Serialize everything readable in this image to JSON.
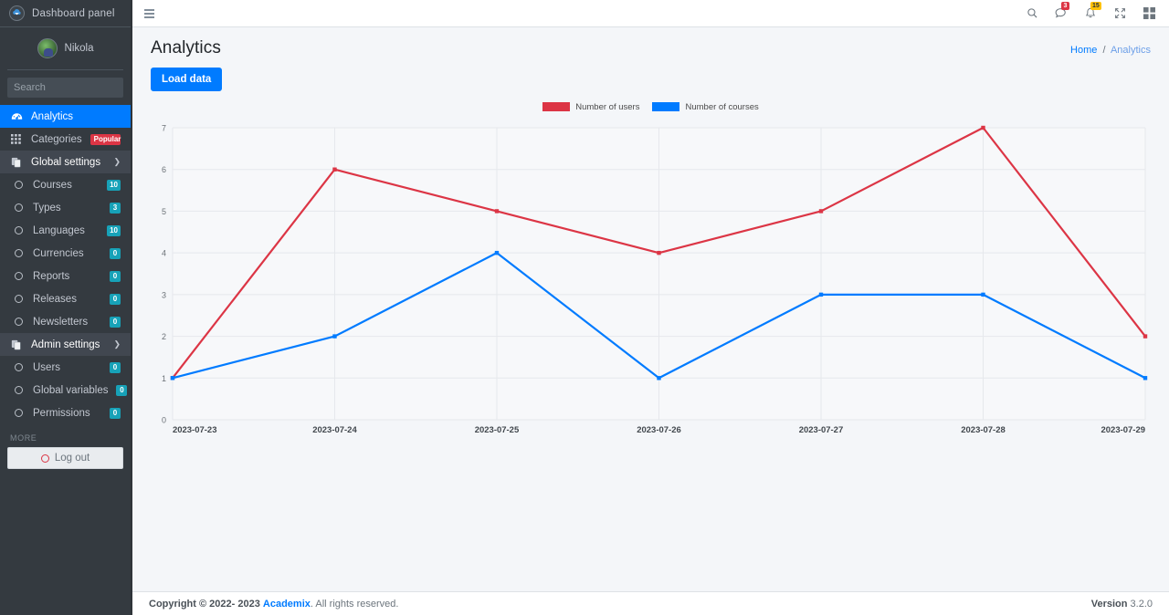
{
  "brand": {
    "title": "Dashboard panel",
    "logo_icon": "cloud-logo-icon"
  },
  "user": {
    "name": "Nikola"
  },
  "search": {
    "placeholder": "Search",
    "value": "",
    "icon": "search-icon"
  },
  "sidebar": {
    "items": [
      {
        "label": "Analytics",
        "icon": "tachometer-icon",
        "state": "active",
        "level": "top"
      },
      {
        "label": "Categories",
        "icon": "grid-icon",
        "badge": "Popular",
        "badge_type": "danger",
        "level": "top"
      },
      {
        "label": "Global settings",
        "icon": "copy-icon",
        "state": "open",
        "chevron": "chevron-down-icon",
        "level": "top"
      },
      {
        "label": "Courses",
        "icon": "circle-icon",
        "badge": "10",
        "badge_type": "info",
        "level": "child"
      },
      {
        "label": "Types",
        "icon": "circle-icon",
        "badge": "3",
        "badge_type": "info",
        "level": "child"
      },
      {
        "label": "Languages",
        "icon": "circle-icon",
        "badge": "10",
        "badge_type": "info",
        "level": "child"
      },
      {
        "label": "Currencies",
        "icon": "circle-icon",
        "badge": "0",
        "badge_type": "info",
        "level": "child"
      },
      {
        "label": "Reports",
        "icon": "circle-icon",
        "badge": "0",
        "badge_type": "info",
        "level": "child"
      },
      {
        "label": "Releases",
        "icon": "circle-icon",
        "badge": "0",
        "badge_type": "info",
        "level": "child"
      },
      {
        "label": "Newsletters",
        "icon": "circle-icon",
        "badge": "0",
        "badge_type": "info",
        "level": "child"
      },
      {
        "label": "Admin settings",
        "icon": "copy-icon",
        "state": "open",
        "chevron": "chevron-down-icon",
        "level": "top"
      },
      {
        "label": "Users",
        "icon": "circle-icon",
        "badge": "0",
        "badge_type": "info",
        "level": "child"
      },
      {
        "label": "Global variables",
        "icon": "circle-icon",
        "badge": "0",
        "badge_type": "info",
        "level": "child"
      },
      {
        "label": "Permissions",
        "icon": "circle-icon",
        "badge": "0",
        "badge_type": "info",
        "level": "child"
      }
    ],
    "more_label": "MORE",
    "logout_label": "Log out",
    "logout_icon": "power-off-icon"
  },
  "topbar": {
    "menu_icon": "hamburger-icon",
    "icons": [
      {
        "name": "search-icon",
        "badge": ""
      },
      {
        "name": "chat-icon",
        "badge": "3",
        "badge_color": "red"
      },
      {
        "name": "bell-icon",
        "badge": "15",
        "badge_color": "yellow"
      },
      {
        "name": "expand-icon",
        "badge": ""
      },
      {
        "name": "widgets-icon",
        "badge": ""
      }
    ]
  },
  "header": {
    "title": "Analytics",
    "breadcrumb": {
      "home": "Home",
      "separator": "/",
      "current": "Analytics"
    }
  },
  "toolbar": {
    "load_data_label": "Load data"
  },
  "footer": {
    "copyright_prefix": "Copyright © 2022- 2023",
    "brand_link": "Academix",
    "copyright_suffix": ". All rights reserved.",
    "version_label": "Version",
    "version_value": "3.2.0"
  },
  "colors": {
    "users": "#dc3545",
    "courses": "#007bff",
    "sidebar_bg": "#343a40",
    "accent": "#007bff"
  },
  "chart_data": {
    "type": "line",
    "title": "",
    "xlabel": "",
    "ylabel": "",
    "categories": [
      "2023-07-23",
      "2023-07-24",
      "2023-07-25",
      "2023-07-26",
      "2023-07-27",
      "2023-07-28",
      "2023-07-29"
    ],
    "series": [
      {
        "name": "Number of users",
        "color": "#dc3545",
        "values": [
          1,
          6,
          5,
          4,
          5,
          7,
          2
        ]
      },
      {
        "name": "Number of courses",
        "color": "#007bff",
        "values": [
          1,
          2,
          4,
          1,
          3,
          3,
          1
        ]
      }
    ],
    "ylim": [
      0,
      7
    ],
    "yticks": [
      0,
      1,
      2,
      3,
      4,
      5,
      6,
      7
    ],
    "grid": true,
    "legend_position": "top-center"
  }
}
